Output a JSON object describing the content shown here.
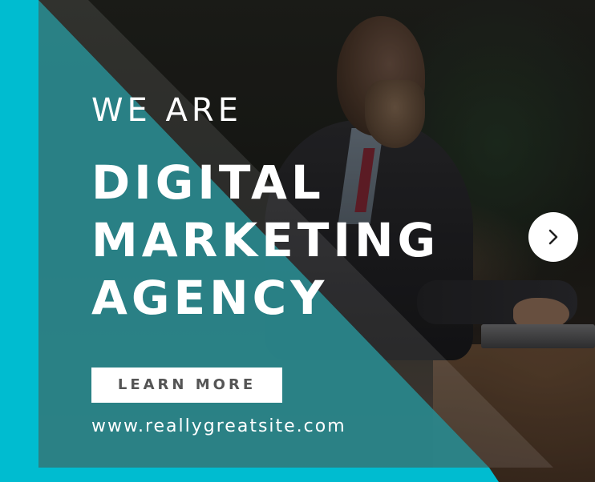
{
  "banner": {
    "eyebrow": "WE ARE",
    "headline_lines": [
      "DIGITAL",
      "MARKETING",
      "AGENCY"
    ],
    "cta_label": "LEARN MORE",
    "website": "www.reallygreatsite.com"
  },
  "colors": {
    "accent_cyan": "#00bcd0",
    "overlay_teal": "#2b8a8f",
    "text": "#ffffff",
    "cta_text": "#555555"
  },
  "icons": {
    "next": "chevron-right-icon"
  }
}
